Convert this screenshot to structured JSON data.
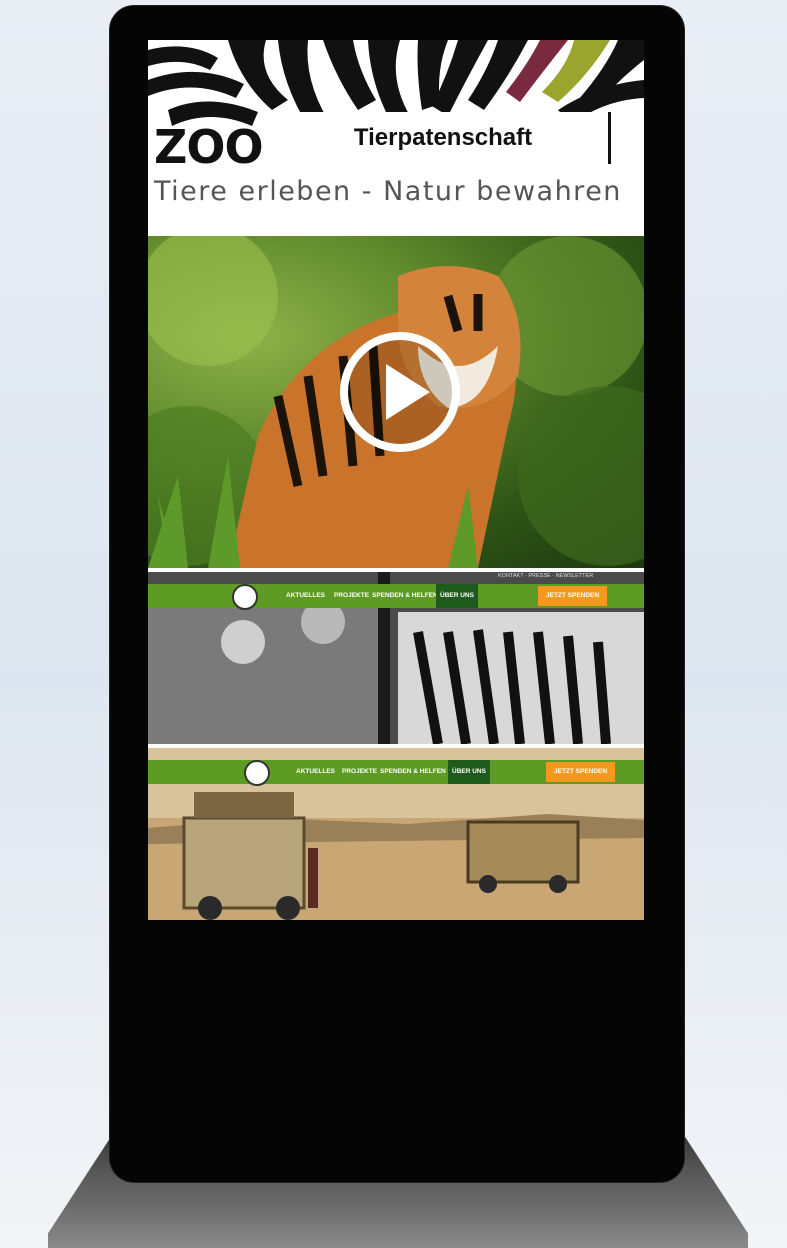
{
  "kiosk": {
    "header": {
      "logo_word": "ZOO",
      "title": "Tierpatenschaft",
      "tagline": "Tiere erleben - Natur bewahren"
    },
    "hero": {
      "play_icon": "play-icon"
    },
    "web_strip_1": {
      "nav": [
        "AKTUELLES",
        "PROJEKTE",
        "SPENDEN & HELFEN",
        "ÜBER UNS"
      ],
      "active": "ÜBER UNS",
      "cta": "JETZT SPENDEN",
      "accent": "#5e9b24",
      "cta_color": "#f39a1e"
    },
    "web_strip_2": {
      "top_links": [
        "KONTAKT",
        "PRESSE",
        "NEWSLETTER"
      ],
      "nav": [
        "AKTUELLES",
        "PROJEKTE",
        "SPENDEN & HELFEN",
        "ÜBER UNS"
      ],
      "active": "ÜBER UNS",
      "cta": "JETZT SPENDEN"
    }
  }
}
